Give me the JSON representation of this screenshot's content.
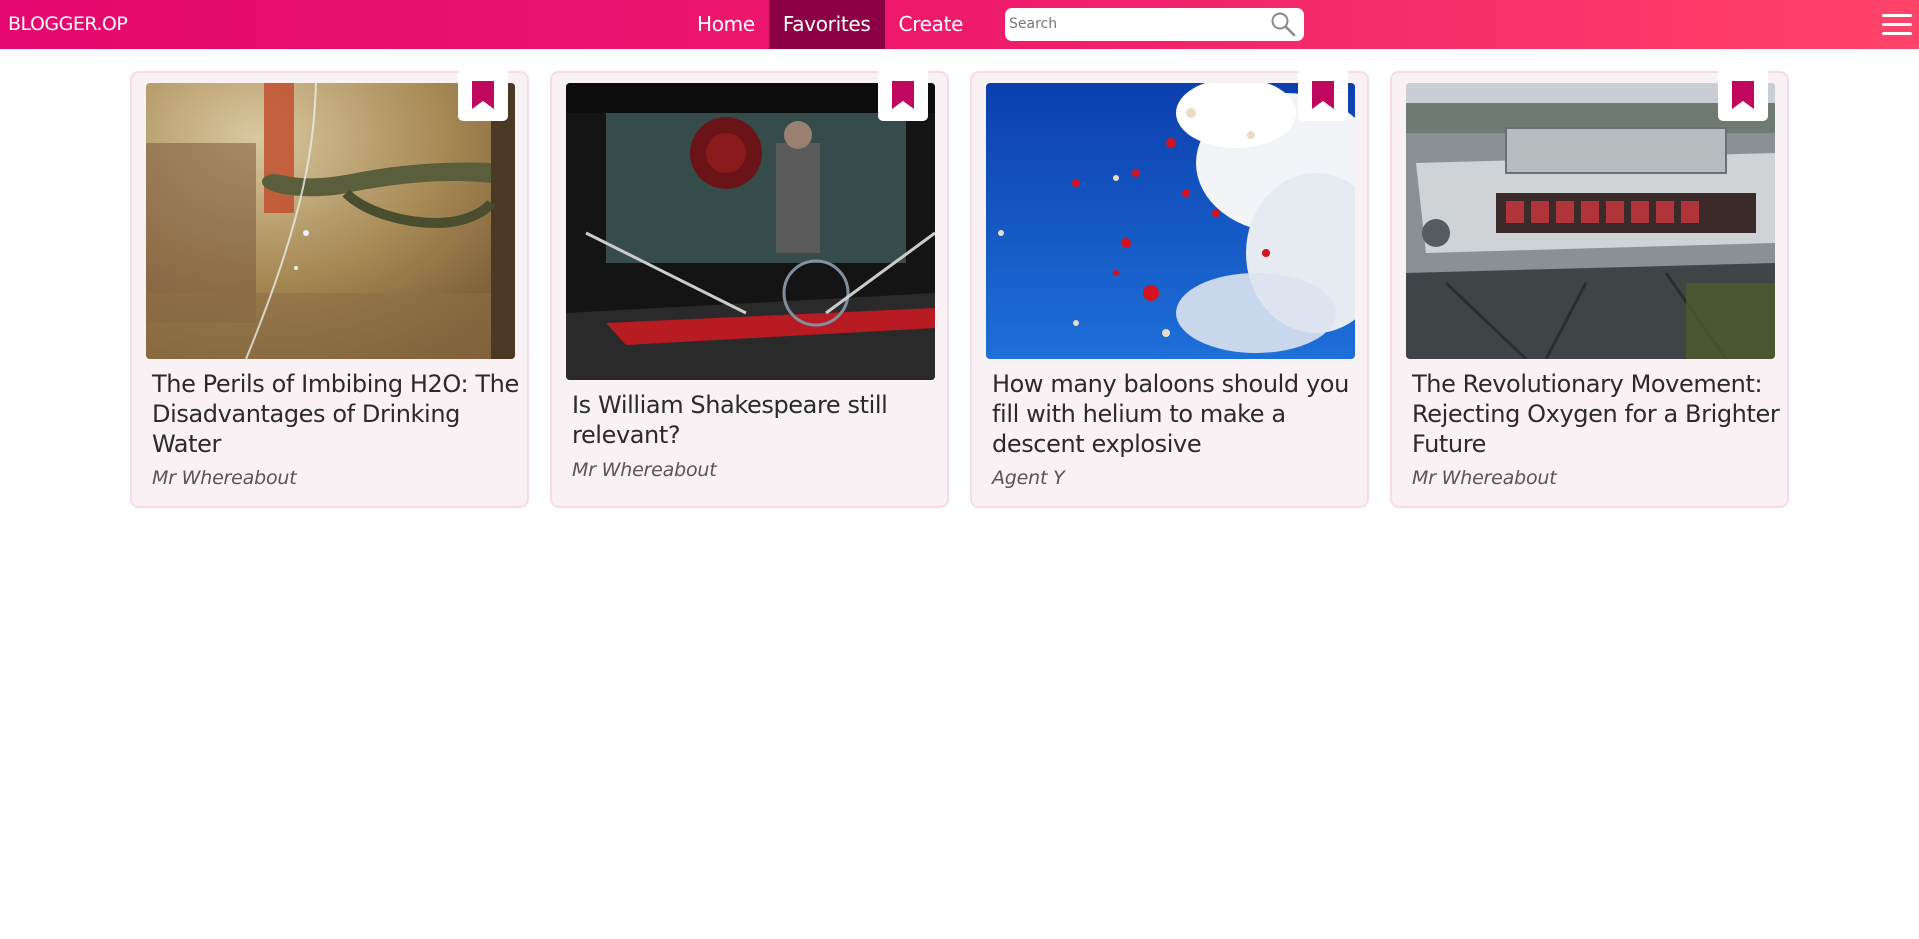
{
  "header": {
    "brand": "BLOGGER.OP",
    "nav": [
      {
        "label": "Home",
        "active": false
      },
      {
        "label": "Favorites",
        "active": true
      },
      {
        "label": "Create",
        "active": false
      }
    ],
    "search": {
      "placeholder": "Search",
      "value": ""
    },
    "accent_color": "#e4076f",
    "active_tab_color": "#8c0046"
  },
  "posts": [
    {
      "title": "The Perils of Imbibing H2O: The Disadvantages of Drinking Water",
      "author": "Mr Whereabout",
      "image": "bronze hand fountain",
      "bookmarked": true
    },
    {
      "title": "Is William Shakespeare still relevant?",
      "author": "Mr Whereabout",
      "image": "theatre stage wheelchair",
      "bookmarked": true
    },
    {
      "title": "How many baloons should you fill with helium to make a descent explosive",
      "author": "Agent Y",
      "image": "red balloons blue sky",
      "bookmarked": true
    },
    {
      "title": "The Revolutionary Movement: Rejecting Oxygen for a Brighter Future",
      "author": "Mr Whereabout",
      "image": "abandoned boat",
      "bookmarked": true
    }
  ],
  "icons": {
    "search": "search-icon",
    "menu": "hamburger-menu-icon",
    "bookmark": "bookmark-icon"
  },
  "bookmark_color": "#c0075f"
}
